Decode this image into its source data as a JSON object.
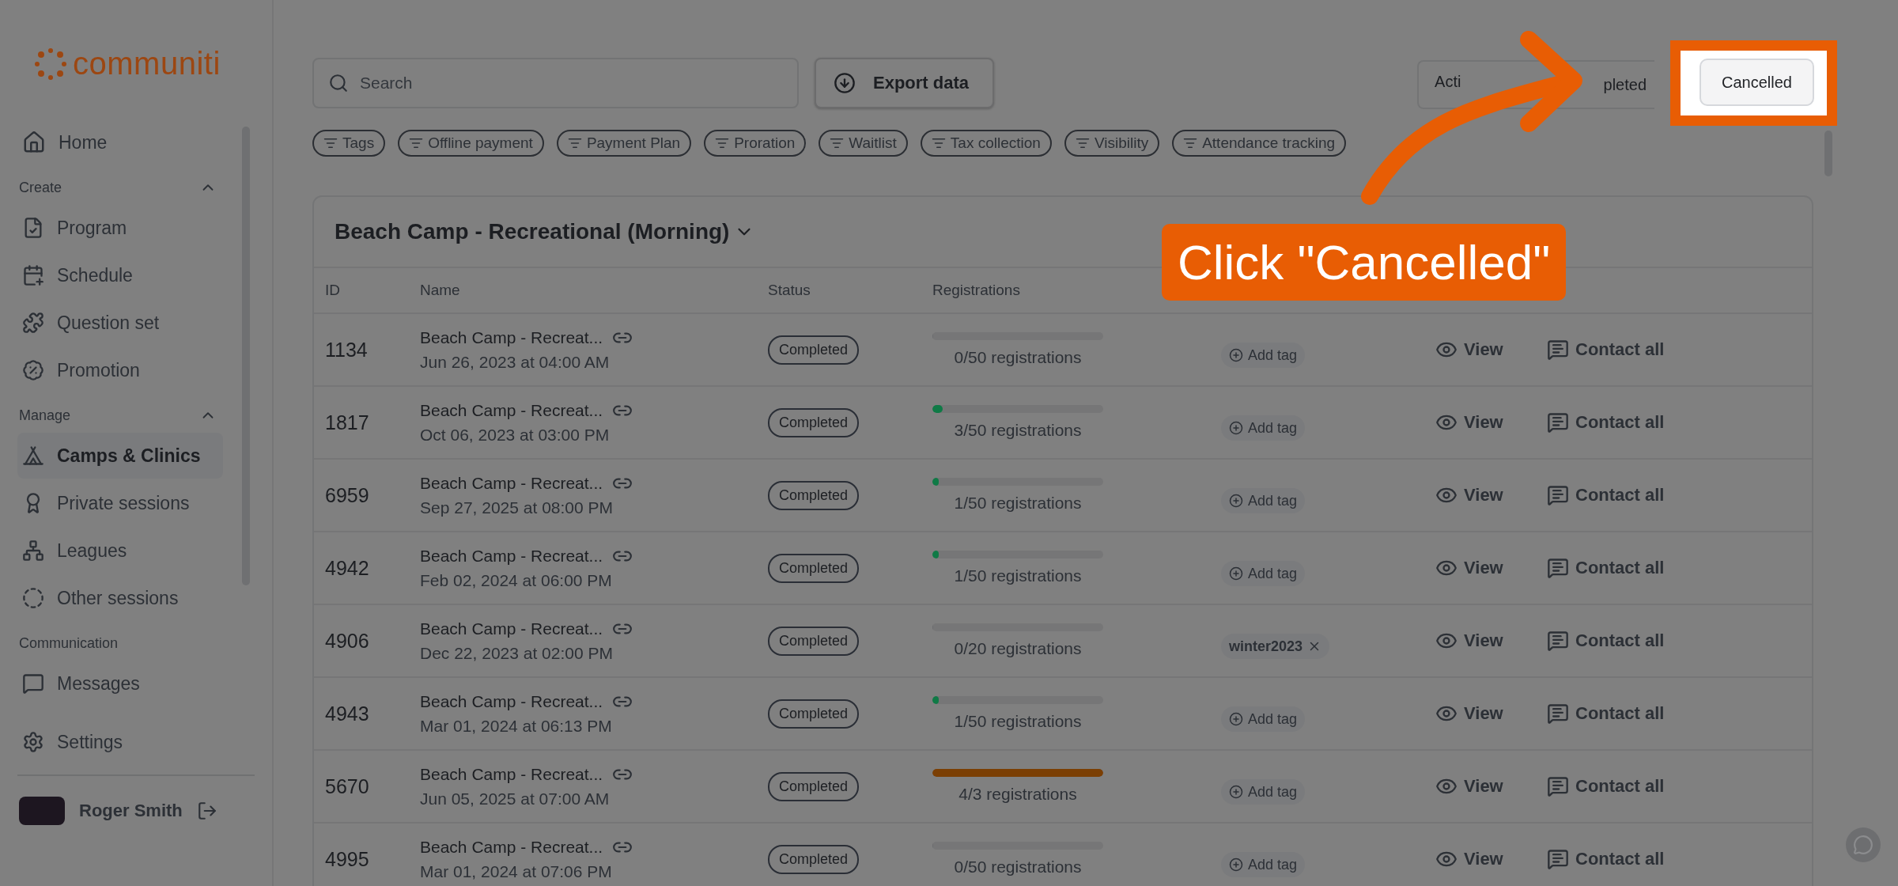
{
  "sidebar": {
    "logo": "communiti",
    "home": {
      "label": "Home",
      "selected": false
    },
    "sections": [
      {
        "title": "Create",
        "expanded": true,
        "items": [
          {
            "label": "Program",
            "selected": false
          },
          {
            "label": "Schedule",
            "selected": false
          },
          {
            "label": "Question set",
            "selected": false
          },
          {
            "label": "Promotion",
            "selected": false
          }
        ]
      },
      {
        "title": "Manage",
        "expanded": true,
        "items": [
          {
            "label": "Camps & Clinics",
            "selected": true
          },
          {
            "label": "Private sessions",
            "selected": false
          },
          {
            "label": "Leagues",
            "selected": false
          },
          {
            "label": "Other sessions",
            "selected": false
          }
        ]
      },
      {
        "title": "Communication",
        "items": [
          {
            "label": "Messages",
            "selected": false
          }
        ]
      }
    ],
    "settings": "Settings",
    "user": "Roger Smith"
  },
  "search": {
    "placeholder": "Search"
  },
  "export": "Export data",
  "filters": [
    "Tags",
    "Offline payment",
    "Payment Plan",
    "Proration",
    "Waitlist",
    "Tax collection",
    "Visibility",
    "Attendance tracking"
  ],
  "segments": [
    {
      "label": "Acti",
      "spotlight": false
    },
    {
      "label": "pleted",
      "spotlight": false
    },
    {
      "label": "Cancelled",
      "spotlight": true
    }
  ],
  "group": {
    "title": "Beach Camp - Recreational (Morning)",
    "expanded": true
  },
  "columns": [
    "ID",
    "Name",
    "Status",
    "Registrations"
  ],
  "rows": [
    {
      "id": "1134",
      "name": "Beach Camp - Recreat...",
      "date": "Jun 26, 2023 at 04:00 AM",
      "status": "Completed",
      "level": 0,
      "registrations": "0/50 registrations",
      "tag": {
        "kind": "add",
        "label": "Add tag"
      },
      "view": "View",
      "contact": "Contact all"
    },
    {
      "id": "1817",
      "name": "Beach Camp - Recreat...",
      "date": "Oct 06, 2023 at 03:00 PM",
      "status": "Completed",
      "level": 0.06,
      "color": "#0f7a46",
      "registrations": "3/50 registrations",
      "tag": {
        "kind": "add",
        "label": "Add tag"
      },
      "view": "View",
      "contact": "Contact all"
    },
    {
      "id": "6959",
      "name": "Beach Camp - Recreat...",
      "date": "Sep 27, 2025 at 08:00 PM",
      "status": "Completed",
      "level": 0.02,
      "color": "#0f7a46",
      "registrations": "1/50 registrations",
      "tag": {
        "kind": "add",
        "label": "Add tag"
      },
      "view": "View",
      "contact": "Contact all"
    },
    {
      "id": "4942",
      "name": "Beach Camp - Recreat...",
      "date": "Feb 02, 2024 at 06:00 PM",
      "status": "Completed",
      "level": 0.02,
      "color": "#0f7a46",
      "registrations": "1/50 registrations",
      "tag": {
        "kind": "add",
        "label": "Add tag"
      },
      "view": "View",
      "contact": "Contact all"
    },
    {
      "id": "4906",
      "name": "Beach Camp - Recreat...",
      "date": "Dec 22, 2023 at 02:00 PM",
      "status": "Completed",
      "level": 0,
      "registrations": "0/20 registrations",
      "tag": {
        "kind": "tag",
        "label": "winter2023"
      },
      "view": "View",
      "contact": "Contact all"
    },
    {
      "id": "4943",
      "name": "Beach Camp - Recreat...",
      "date": "Mar 01, 2024 at 06:13 PM",
      "status": "Completed",
      "level": 0.02,
      "color": "#0f7a46",
      "registrations": "1/50 registrations",
      "tag": {
        "kind": "add",
        "label": "Add tag"
      },
      "view": "View",
      "contact": "Contact all"
    },
    {
      "id": "5670",
      "name": "Beach Camp - Recreat...",
      "date": "Jun 05, 2025 at 07:00 AM",
      "status": "Completed",
      "level": 1,
      "color": "#7b3f04",
      "registrations": "4/3 registrations",
      "tag": {
        "kind": "add",
        "label": "Add tag"
      },
      "view": "View",
      "contact": "Contact all"
    },
    {
      "id": "4995",
      "name": "Beach Camp - Recreat...",
      "date": "Mar 01, 2024 at 07:06 PM",
      "status": "Completed",
      "level": 0,
      "registrations": "0/50 registrations",
      "tag": {
        "kind": "add",
        "label": "Add tag"
      },
      "view": "View",
      "contact": "Contact all"
    }
  ],
  "callout": "Click \"Cancelled\""
}
